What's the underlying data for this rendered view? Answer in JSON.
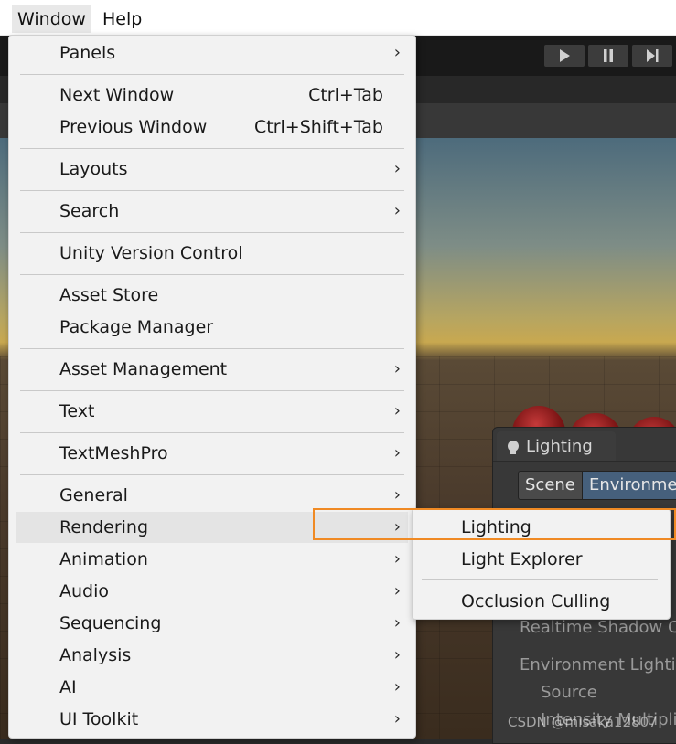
{
  "menubar": {
    "items": [
      "Window",
      "Help"
    ]
  },
  "window_menu": {
    "items": [
      {
        "label": "Panels",
        "shortcut": "",
        "submenu": true
      },
      {
        "label": "Next Window",
        "shortcut": "Ctrl+Tab",
        "submenu": false
      },
      {
        "label": "Previous Window",
        "shortcut": "Ctrl+Shift+Tab",
        "submenu": false
      },
      {
        "label": "Layouts",
        "shortcut": "",
        "submenu": true
      },
      {
        "label": "Search",
        "shortcut": "",
        "submenu": true
      },
      {
        "label": "Unity Version Control",
        "shortcut": "",
        "submenu": false
      },
      {
        "label": "Asset Store",
        "shortcut": "",
        "submenu": false
      },
      {
        "label": "Package Manager",
        "shortcut": "",
        "submenu": false
      },
      {
        "label": "Asset Management",
        "shortcut": "",
        "submenu": true
      },
      {
        "label": "Text",
        "shortcut": "",
        "submenu": true
      },
      {
        "label": "TextMeshPro",
        "shortcut": "",
        "submenu": true
      },
      {
        "label": "General",
        "shortcut": "",
        "submenu": true
      },
      {
        "label": "Rendering",
        "shortcut": "",
        "submenu": true,
        "highlighted": true
      },
      {
        "label": "Animation",
        "shortcut": "",
        "submenu": true
      },
      {
        "label": "Audio",
        "shortcut": "",
        "submenu": true
      },
      {
        "label": "Sequencing",
        "shortcut": "",
        "submenu": true
      },
      {
        "label": "Analysis",
        "shortcut": "",
        "submenu": true
      },
      {
        "label": "AI",
        "shortcut": "",
        "submenu": true
      },
      {
        "label": "UI Toolkit",
        "shortcut": "",
        "submenu": true
      }
    ],
    "arrow_glyph": "›"
  },
  "rendering_submenu": {
    "items": [
      "Lighting",
      "Light Explorer",
      "Occlusion Culling"
    ],
    "highlighted": "Lighting"
  },
  "lighting_window": {
    "title": "Lighting",
    "tabs": [
      "Scene",
      "Environmer"
    ],
    "labels": [
      "Realtime Shadow C",
      "Environment Lightin",
      "Source",
      "Intensity Multiplie"
    ]
  },
  "watermark": "CSDN @misaka12807",
  "colors": {
    "highlight_outline": "#f08a24",
    "menu_bg": "#f2f2f2",
    "selected_tab": "#46607c"
  }
}
